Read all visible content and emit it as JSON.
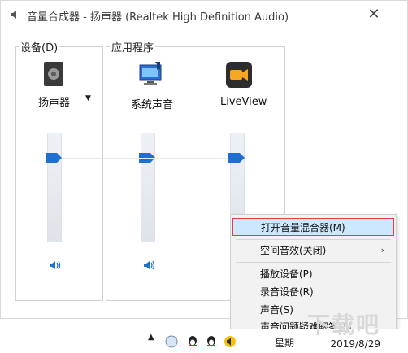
{
  "window": {
    "title": "音量合成器 - 扬声器 (Realtek High Definition Audio)",
    "close_glyph": "✕"
  },
  "sections": {
    "devices_label": "设备(D)",
    "apps_label": "应用程序"
  },
  "channels": [
    {
      "name": "扬声器",
      "icon": "speaker-device-icon",
      "has_dropdown": true,
      "level": 0.75
    },
    {
      "name": "系统声音",
      "icon": "system-sounds-icon",
      "has_dropdown": false,
      "level": 0.75
    },
    {
      "name": "LiveView",
      "icon": "liveview-app-icon",
      "has_dropdown": false,
      "level": 0.75
    }
  ],
  "context_menu": {
    "items": [
      {
        "label": "打开音量混合器(M)",
        "highlighted": true,
        "submenu": false
      },
      {
        "label": "空间音效(关闭)",
        "highlighted": false,
        "submenu": true
      },
      {
        "label": "播放设备(P)",
        "highlighted": false,
        "submenu": false
      },
      {
        "label": "录音设备(R)",
        "highlighted": false,
        "submenu": false
      },
      {
        "label": "声音(S)",
        "highlighted": false,
        "submenu": false
      },
      {
        "label": "声音问题疑难解答(T)",
        "highlighted": false,
        "submenu": false
      }
    ]
  },
  "taskbar": {
    "time_partial": "星期",
    "date": "2019/8/29"
  },
  "watermark": "下载吧",
  "colors": {
    "accent": "#1f6fd0",
    "highlight": "#cce8ff",
    "highlight_border": "#e04040"
  }
}
